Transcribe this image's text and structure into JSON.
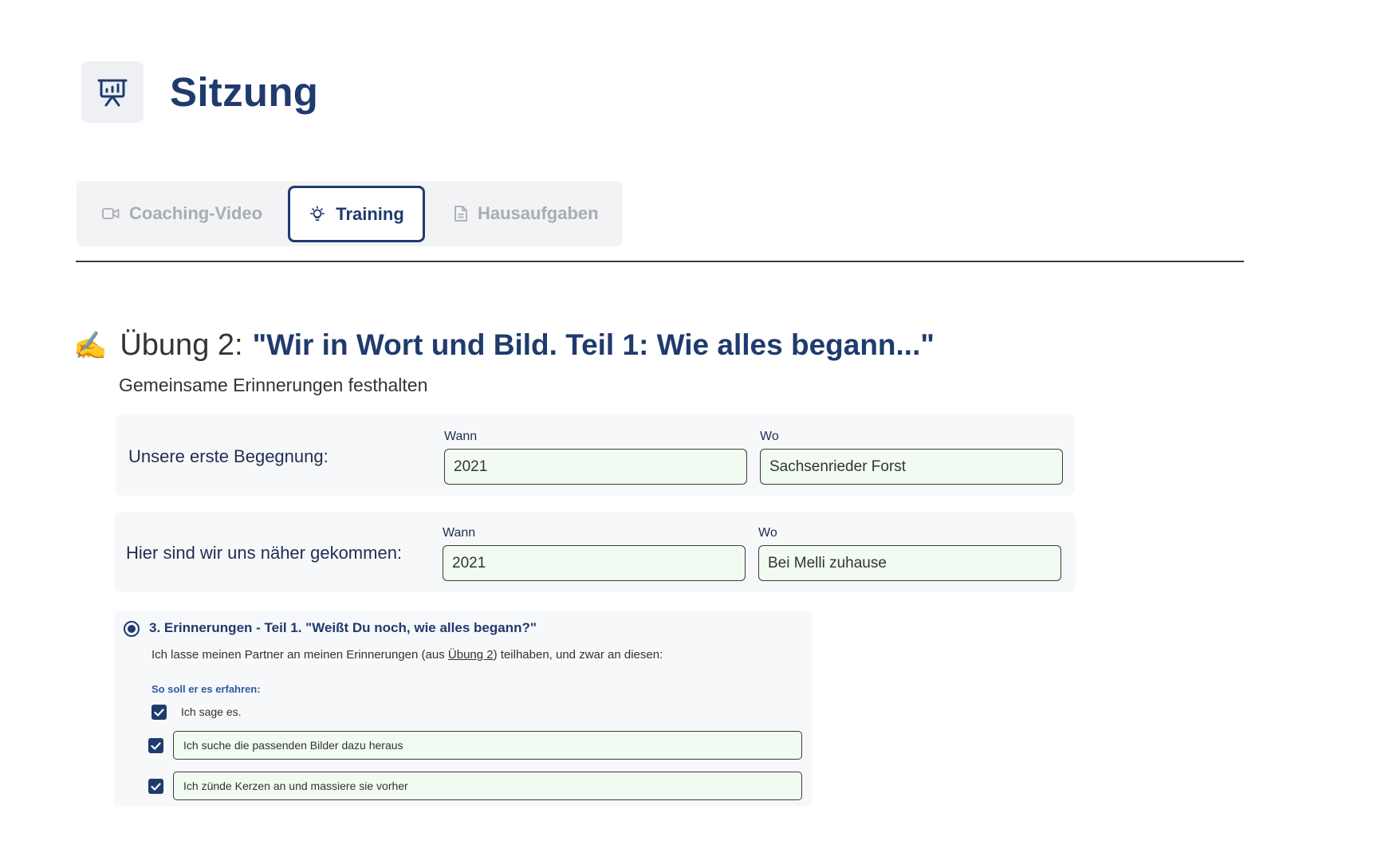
{
  "page": {
    "title": "Sitzung",
    "icon": "presentation-board-icon"
  },
  "tabs": [
    {
      "label": "Coaching-Video",
      "icon": "video-camera-icon",
      "active": false
    },
    {
      "label": "Training",
      "icon": "lightbulb-icon",
      "active": true
    },
    {
      "label": "Hausaufgaben",
      "icon": "document-icon",
      "active": false
    }
  ],
  "exercise": {
    "emoji": "✍️",
    "prefix": "Übung 2:",
    "title": "\"Wir in Wort und Bild. Teil 1: Wie alles begann...\"",
    "subtitle": "Gemeinsame Erinnerungen festhalten"
  },
  "cards": [
    {
      "label": "Unsere erste Begegnung:",
      "when_label": "Wann",
      "when_value": "2021",
      "where_label": "Wo",
      "where_value": "Sachsenrieder Forst"
    },
    {
      "label": "Hier sind wir uns näher gekommen:",
      "when_label": "Wann",
      "when_value": "2021",
      "where_label": "Wo",
      "where_value": "Bei Melli zuhause"
    }
  ],
  "memories": {
    "title": "3. Erinnerungen - Teil 1. \"Weißt Du noch, wie alles begann?\"",
    "text_before": "Ich lasse meinen Partner an meinen Erinnerungen (aus ",
    "text_link": "Übung 2",
    "text_after": ") teilhaben, und zwar an diesen:",
    "howto_label": "So soll er es erfahren:",
    "options": [
      {
        "checked": true,
        "text": "Ich sage es."
      },
      {
        "checked": true,
        "value": "Ich suche die passenden Bilder dazu heraus"
      },
      {
        "checked": true,
        "value": "Ich zünde Kerzen an und massiere sie vorher"
      }
    ]
  },
  "colors": {
    "brand": "#1f3b6e",
    "field_bg": "#f1fbf1",
    "card_bg": "#f7f8fa"
  }
}
